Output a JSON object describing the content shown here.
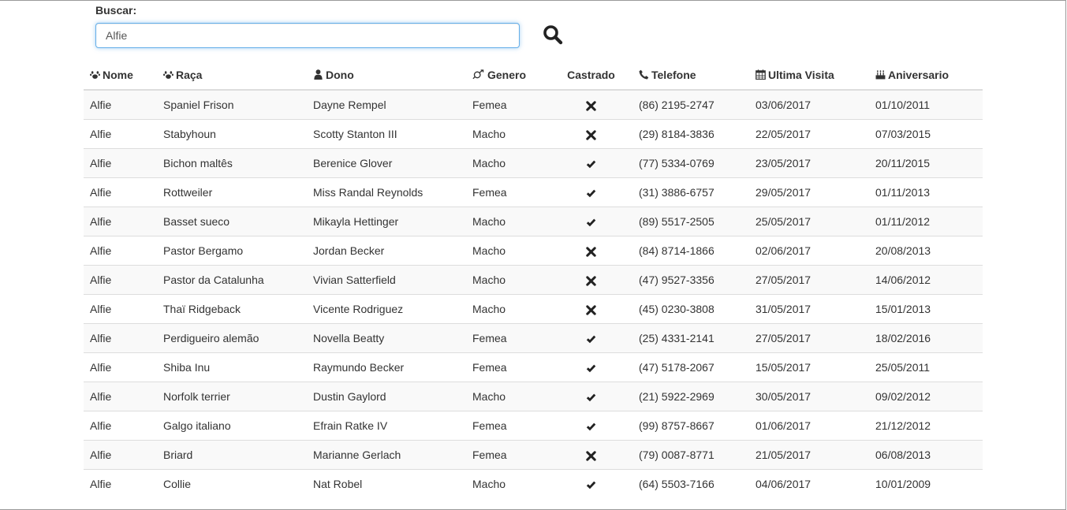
{
  "search": {
    "label": "Buscar:",
    "value": "Alfie",
    "button_icon": "search-icon"
  },
  "table": {
    "columns": [
      {
        "label": "Nome",
        "icon": "paw-icon"
      },
      {
        "label": "Raça",
        "icon": "paw-icon"
      },
      {
        "label": "Dono",
        "icon": "user-icon"
      },
      {
        "label": "Genero",
        "icon": "gender-icon"
      },
      {
        "label": "Castrado",
        "icon": ""
      },
      {
        "label": "Telefone",
        "icon": "phone-icon"
      },
      {
        "label": "Ultima Visita",
        "icon": "calendar-icon"
      },
      {
        "label": "Aniversario",
        "icon": "cake-icon"
      }
    ],
    "rows": [
      {
        "nome": "Alfie",
        "raca": "Spaniel Frison",
        "dono": "Dayne Rempel",
        "genero": "Femea",
        "castrado": false,
        "telefone": "(86) 2195-2747",
        "ultima_visita": "03/06/2017",
        "aniversario": "01/10/2011"
      },
      {
        "nome": "Alfie",
        "raca": "Stabyhoun",
        "dono": "Scotty Stanton III",
        "genero": "Macho",
        "castrado": false,
        "telefone": "(29) 8184-3836",
        "ultima_visita": "22/05/2017",
        "aniversario": "07/03/2015"
      },
      {
        "nome": "Alfie",
        "raca": "Bichon maltês",
        "dono": "Berenice Glover",
        "genero": "Macho",
        "castrado": true,
        "telefone": "(77) 5334-0769",
        "ultima_visita": "23/05/2017",
        "aniversario": "20/11/2015"
      },
      {
        "nome": "Alfie",
        "raca": "Rottweiler",
        "dono": "Miss Randal Reynolds",
        "genero": "Femea",
        "castrado": true,
        "telefone": "(31) 3886-6757",
        "ultima_visita": "29/05/2017",
        "aniversario": "01/11/2013"
      },
      {
        "nome": "Alfie",
        "raca": "Basset sueco",
        "dono": "Mikayla Hettinger",
        "genero": "Macho",
        "castrado": true,
        "telefone": "(89) 5517-2505",
        "ultima_visita": "25/05/2017",
        "aniversario": "01/11/2012"
      },
      {
        "nome": "Alfie",
        "raca": "Pastor Bergamo",
        "dono": "Jordan Becker",
        "genero": "Macho",
        "castrado": false,
        "telefone": "(84) 8714-1866",
        "ultima_visita": "02/06/2017",
        "aniversario": "20/08/2013"
      },
      {
        "nome": "Alfie",
        "raca": "Pastor da Catalunha",
        "dono": "Vivian Satterfield",
        "genero": "Macho",
        "castrado": false,
        "telefone": "(47) 9527-3356",
        "ultima_visita": "27/05/2017",
        "aniversario": "14/06/2012"
      },
      {
        "nome": "Alfie",
        "raca": "Thaï Ridgeback",
        "dono": "Vicente Rodriguez",
        "genero": "Macho",
        "castrado": false,
        "telefone": "(45) 0230-3808",
        "ultima_visita": "31/05/2017",
        "aniversario": "15/01/2013"
      },
      {
        "nome": "Alfie",
        "raca": "Perdigueiro alemão",
        "dono": "Novella Beatty",
        "genero": "Femea",
        "castrado": true,
        "telefone": "(25) 4331-2141",
        "ultima_visita": "27/05/2017",
        "aniversario": "18/02/2016"
      },
      {
        "nome": "Alfie",
        "raca": "Shiba Inu",
        "dono": "Raymundo Becker",
        "genero": "Femea",
        "castrado": true,
        "telefone": "(47) 5178-2067",
        "ultima_visita": "15/05/2017",
        "aniversario": "25/05/2011"
      },
      {
        "nome": "Alfie",
        "raca": "Norfolk terrier",
        "dono": "Dustin Gaylord",
        "genero": "Macho",
        "castrado": true,
        "telefone": "(21) 5922-2969",
        "ultima_visita": "30/05/2017",
        "aniversario": "09/02/2012"
      },
      {
        "nome": "Alfie",
        "raca": "Galgo italiano",
        "dono": "Efrain Ratke IV",
        "genero": "Femea",
        "castrado": true,
        "telefone": "(99) 8757-8667",
        "ultima_visita": "01/06/2017",
        "aniversario": "21/12/2012"
      },
      {
        "nome": "Alfie",
        "raca": "Briard",
        "dono": "Marianne Gerlach",
        "genero": "Femea",
        "castrado": false,
        "telefone": "(79) 0087-8771",
        "ultima_visita": "21/05/2017",
        "aniversario": "06/08/2013"
      },
      {
        "nome": "Alfie",
        "raca": "Collie",
        "dono": "Nat Robel",
        "genero": "Macho",
        "castrado": true,
        "telefone": "(64) 5503-7166",
        "ultima_visita": "04/06/2017",
        "aniversario": "10/01/2009"
      }
    ]
  },
  "icons": {
    "castrado_true": "check-icon",
    "castrado_false": "cross-icon"
  }
}
